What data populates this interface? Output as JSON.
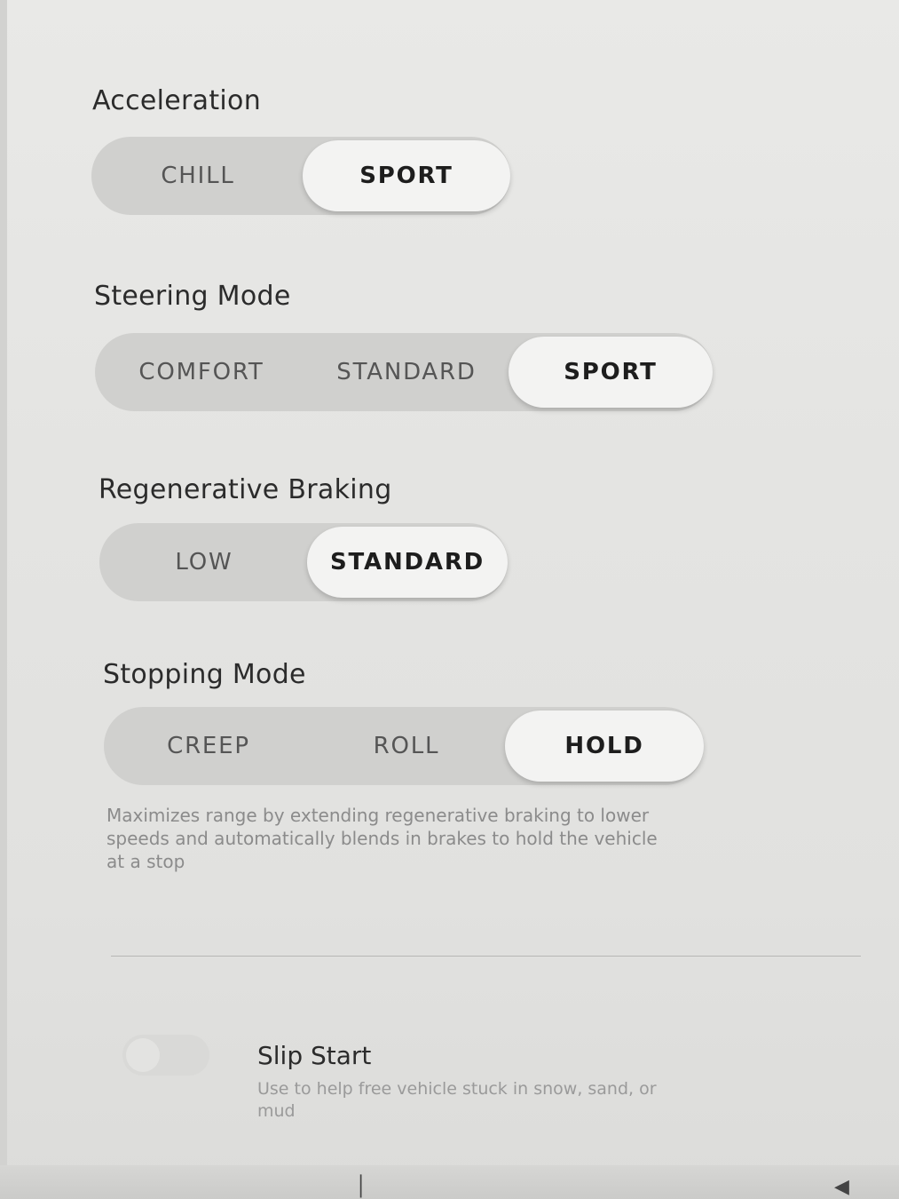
{
  "acceleration": {
    "label": "Acceleration",
    "options": [
      "CHILL",
      "SPORT"
    ],
    "selected": "SPORT"
  },
  "steering": {
    "label": "Steering Mode",
    "options": [
      "COMFORT",
      "STANDARD",
      "SPORT"
    ],
    "selected": "SPORT"
  },
  "regen": {
    "label": "Regenerative Braking",
    "options": [
      "LOW",
      "STANDARD"
    ],
    "selected": "STANDARD"
  },
  "stopping": {
    "label": "Stopping Mode",
    "options": [
      "CREEP",
      "ROLL",
      "HOLD"
    ],
    "selected": "HOLD",
    "description": "Maximizes range by extending regenerative braking to lower speeds and automatically blends in brakes to hold the vehicle at a stop"
  },
  "slip_start": {
    "title": "Slip Start",
    "description": "Use to help free vehicle stuck in snow, sand, or mud",
    "enabled": false
  },
  "colors": {
    "active_option": "#f3f3f2",
    "track": "#d0d0ce",
    "text_dark": "#1d1d1d"
  },
  "bottom_icons": [
    "temperature-icon",
    "volume-icon"
  ]
}
